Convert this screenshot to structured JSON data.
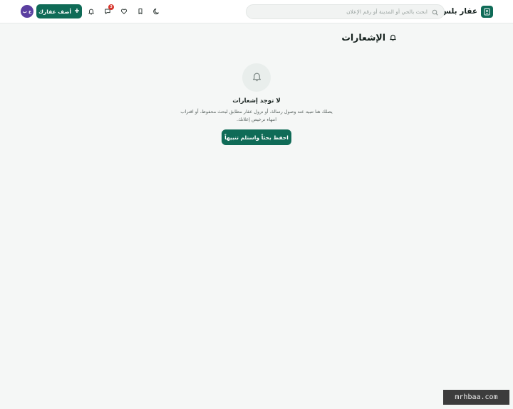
{
  "header": {
    "brand_name": "عقار بلس",
    "search_placeholder": "ابحث بالحي أو المدينة أو رقم الإعلان",
    "messages_badge": "3",
    "add_button_label": "أضف عقارك",
    "avatar_initials": "ع ب",
    "icons": {
      "logo": "building-icon",
      "search": "search-icon",
      "theme": "moon-icon",
      "saved": "bookmark-icon",
      "favorites": "heart-icon",
      "messages": "chat-icon",
      "notifications": "bell-icon",
      "add": "plus-icon"
    }
  },
  "page": {
    "title": "الإشعارات",
    "title_icon": "bell-icon"
  },
  "empty_state": {
    "icon": "bell-icon",
    "heading": "لا توجد إشعارات",
    "description": "يصلك هنا تنبيه عند وصول رسالة، أو نزول عقار مطابق لبحث محفوظ، أو اقتراب انتهاء ترخيص إعلانك.",
    "cta_label": "احفظ بحثاً واستلم تنبيهاً"
  },
  "watermark": "mrhbaa.com",
  "colors": {
    "primary": "#0f6b57",
    "badge": "#d6342b",
    "avatar": "#5b3fa0",
    "background": "#f5f7f6"
  }
}
